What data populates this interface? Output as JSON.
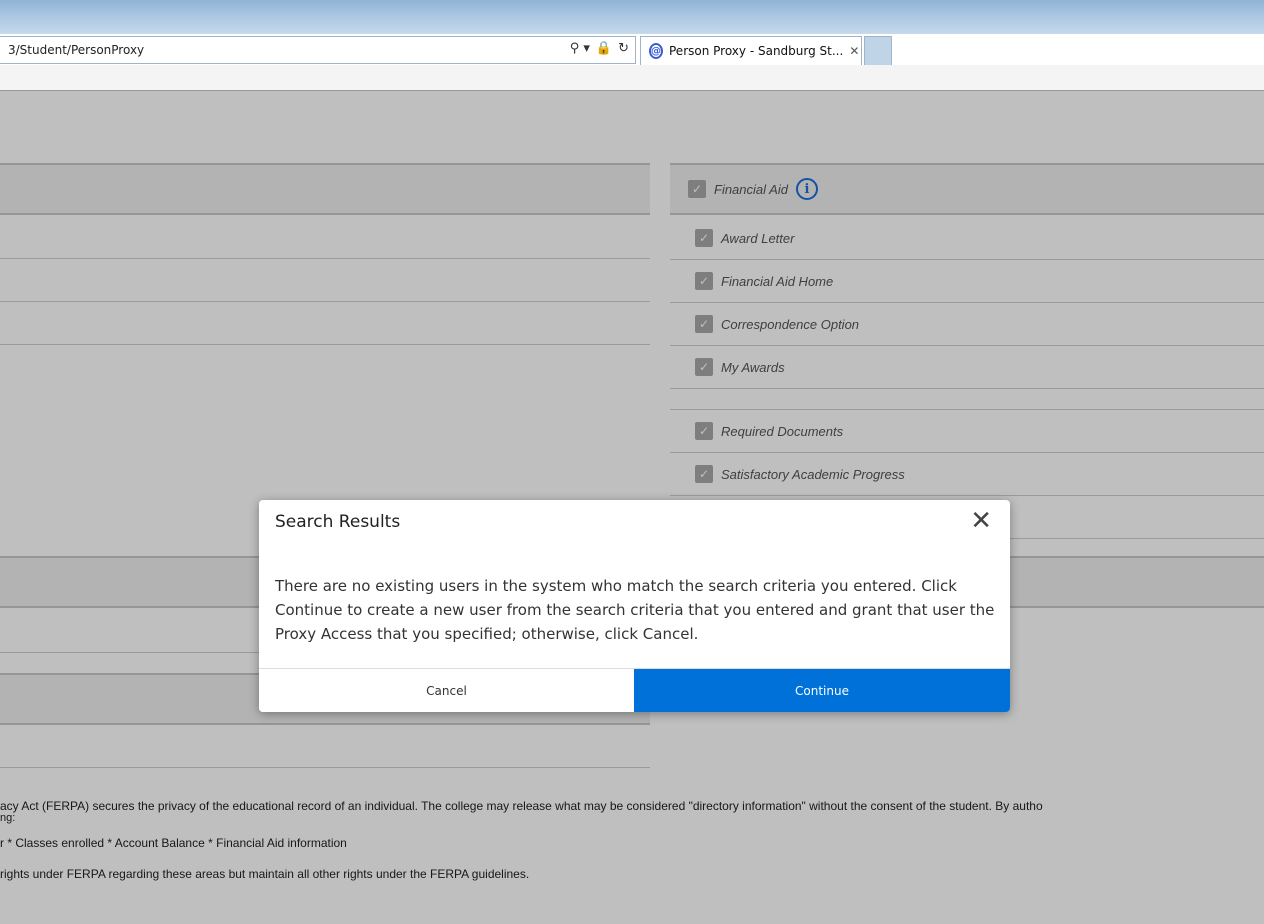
{
  "browser": {
    "url": "3/Student/PersonProxy",
    "tab_title": "Person Proxy - Sandburg St...",
    "tab_close": "✕",
    "address_tools": [
      "⚲ ▾",
      "🔒",
      "↻"
    ]
  },
  "financial_aid": {
    "header_label": "Financial Aid",
    "items": [
      {
        "label": "Award Letter"
      },
      {
        "label": "Financial Aid Home"
      },
      {
        "label": "Correspondence Option"
      },
      {
        "label": "My Awards"
      },
      {
        "label": "Required Documents"
      },
      {
        "label": "Satisfactory Academic Progress"
      }
    ]
  },
  "footer": {
    "line1": "acy Act (FERPA) secures the privacy of the educational record of an individual. The college may release what may be considered \"directory information\" without the consent of the student. By autho",
    "line1b": "ng:",
    "line2": "r * Classes enrolled * Account Balance * Financial Aid information",
    "line3": "rights under FERPA regarding these areas but maintain all other rights under the FERPA guidelines."
  },
  "modal": {
    "title": "Search Results",
    "close_glyph": "✕",
    "body": "There are no existing users in the system who match the search criteria you entered. Click Continue to create a new user from the search criteria that you entered and grant that user the Proxy Access that you specified; otherwise, click Cancel.",
    "cancel_label": "Cancel",
    "continue_label": "Continue"
  },
  "colors": {
    "primary": "#0071d9",
    "info": "#1a6fd8"
  }
}
